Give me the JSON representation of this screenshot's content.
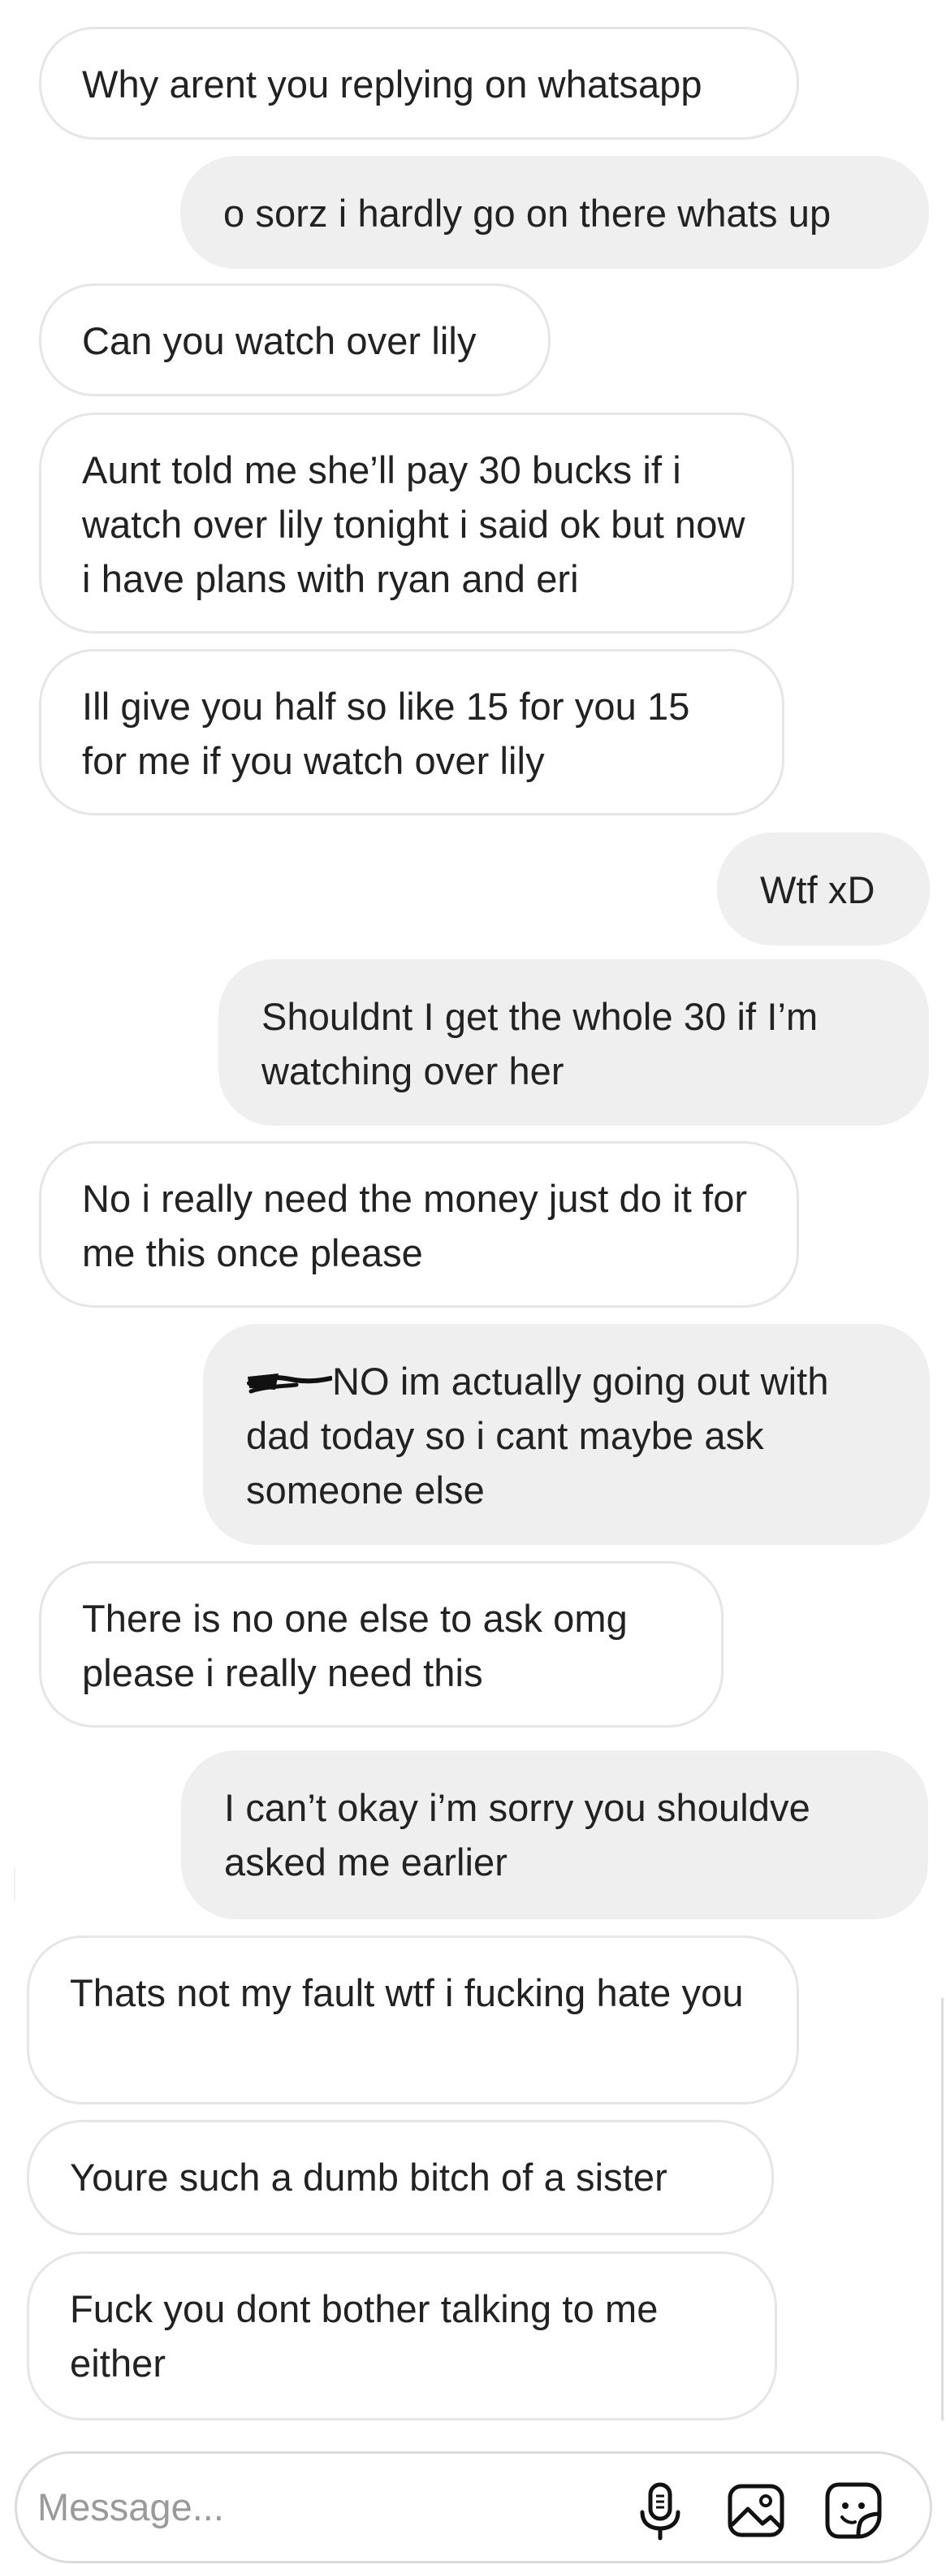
{
  "conversation": {
    "messages": [
      {
        "side": "in",
        "text": "Why arent you replying on whatsapp"
      },
      {
        "side": "out",
        "text": "o sorz i hardly go on there whats up"
      },
      {
        "side": "in",
        "text": "Can you watch over lily"
      },
      {
        "side": "in",
        "text": "Aunt told me she’ll pay 30 bucks if i watch over lily tonight i said ok but now i have plans with ryan and eri"
      },
      {
        "side": "in",
        "text": "Ill give you half so like 15 for you 15 for me if you watch over lily"
      },
      {
        "side": "out",
        "text": "Wtf xD"
      },
      {
        "side": "out",
        "text": "Shouldnt I get the whole 30 if I’m watching over her"
      },
      {
        "side": "in",
        "text": "No i really need the money just do it for me this once please"
      },
      {
        "side": "out",
        "text": "NO im actually going out with dad today so i cant maybe ask someone else"
      },
      {
        "side": "in",
        "text": "There is no one else to ask omg please i really need this"
      },
      {
        "side": "out",
        "text": "I can’t okay i’m sorry you shouldve asked me earlier"
      },
      {
        "side": "in",
        "text": "Thats not my fault wtf i fucking hate you"
      },
      {
        "side": "in",
        "text": "Youre such a dumb bitch of a sister"
      },
      {
        "side": "in",
        "text": "Fuck you dont bother talking to me either"
      }
    ]
  },
  "composer": {
    "placeholder": "Message...",
    "value": "",
    "icons": [
      "microphone-icon",
      "image-icon",
      "sticker-icon"
    ]
  },
  "colors": {
    "incoming_bg": "#ffffff",
    "incoming_border": "#e6e6e6",
    "outgoing_bg": "#efefef",
    "text": "#222222",
    "placeholder": "#9a9a9a"
  }
}
